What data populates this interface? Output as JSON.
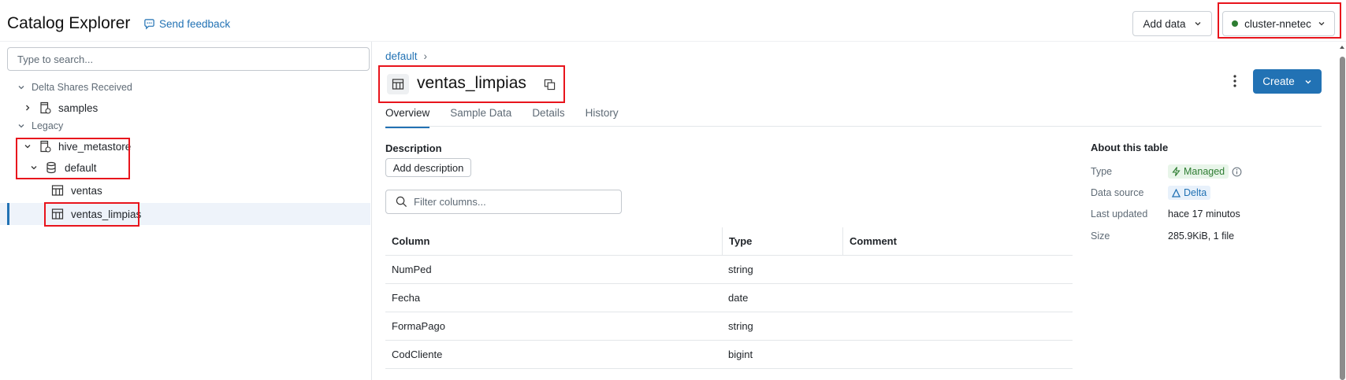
{
  "header": {
    "app_title": "Catalog Explorer",
    "feedback_label": "Send feedback",
    "add_data_label": "Add data",
    "cluster_label": "cluster-nnetec",
    "cluster_status_color": "#2e7d32"
  },
  "sidebar": {
    "search_placeholder": "Type to search...",
    "section_delta": "Delta Shares Received",
    "item_samples": "samples",
    "section_legacy": "Legacy",
    "item_hive": "hive_metastore",
    "item_default": "default",
    "item_ventas": "ventas",
    "item_ventas_limpias": "ventas_limpias"
  },
  "main": {
    "breadcrumb": "default",
    "breadcrumb_sep": "›",
    "table_name": "ventas_limpias",
    "create_label": "Create",
    "tabs": [
      "Overview",
      "Sample Data",
      "Details",
      "History"
    ],
    "active_tab": "Overview",
    "description_label": "Description",
    "add_description_label": "Add description",
    "filter_placeholder": "Filter columns...",
    "columns_headers": [
      "Column",
      "Type",
      "Comment"
    ],
    "columns": [
      {
        "name": "NumPed",
        "type": "string",
        "comment": ""
      },
      {
        "name": "Fecha",
        "type": "date",
        "comment": ""
      },
      {
        "name": "FormaPago",
        "type": "string",
        "comment": ""
      },
      {
        "name": "CodCliente",
        "type": "bigint",
        "comment": ""
      }
    ]
  },
  "about": {
    "title": "About this table",
    "type_key": "Type",
    "type_val": "Managed",
    "source_key": "Data source",
    "source_val": "Delta",
    "updated_key": "Last updated",
    "updated_val": "hace 17 minutos",
    "size_key": "Size",
    "size_val": "285.9KiB, 1 file"
  },
  "colors": {
    "accent": "#2272b4",
    "highlight_box": "#e8141c"
  }
}
